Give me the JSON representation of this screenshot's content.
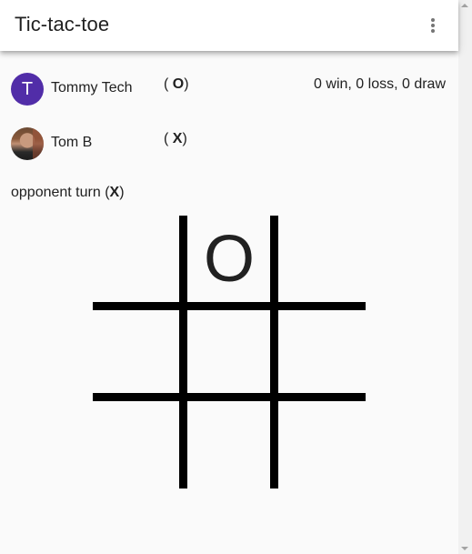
{
  "app": {
    "title": "Tic-tac-toe",
    "menu_icon": "more-vert-icon"
  },
  "players": [
    {
      "name": "Tommy Tech",
      "avatar_letter": "T",
      "avatar_color": "#512DA8",
      "mark_open": "( ",
      "mark": "O",
      "mark_close": ")",
      "record": "0 win, 0 loss, 0 draw"
    },
    {
      "name": "Tom B",
      "avatar": "photo",
      "mark_open": "( ",
      "mark": "X",
      "mark_close": ")"
    }
  ],
  "status": {
    "prefix": "opponent turn (",
    "mark": "X",
    "suffix": ")"
  },
  "board": {
    "cells": [
      "",
      "O",
      "",
      "",
      "",
      "",
      "",
      "",
      ""
    ],
    "line_color": "#000000"
  }
}
